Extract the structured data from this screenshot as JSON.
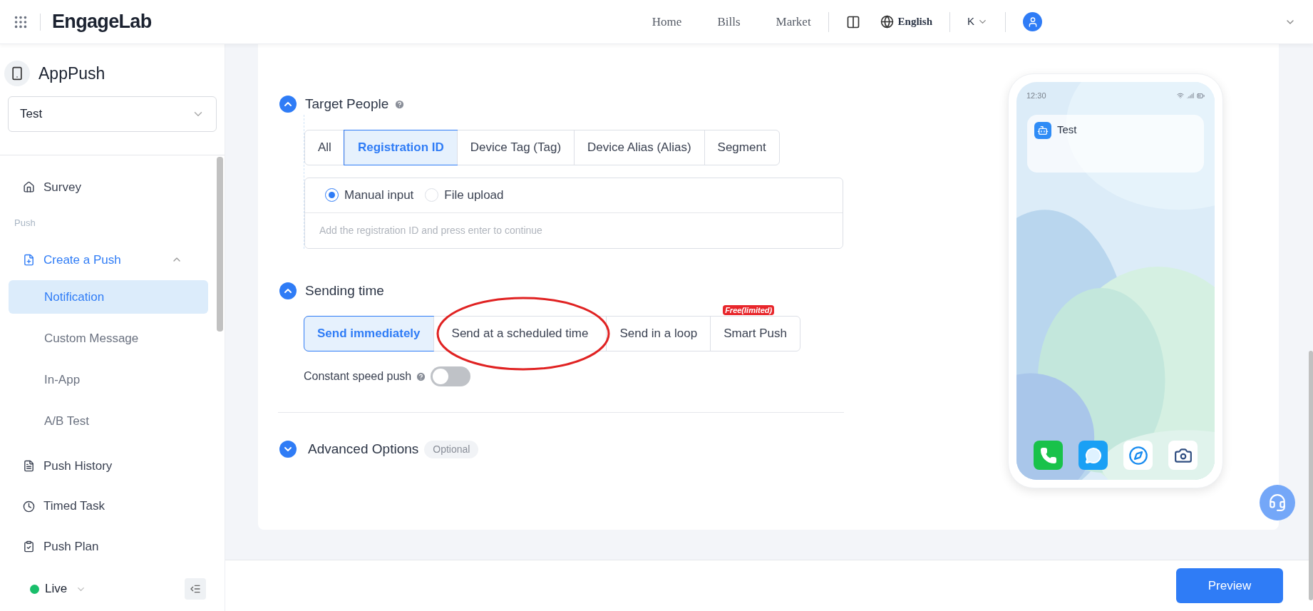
{
  "header": {
    "logo": "EngageLab",
    "nav": [
      {
        "label": "Home"
      },
      {
        "label": "Bills"
      },
      {
        "label": "Market"
      }
    ],
    "language": "English",
    "account": "K"
  },
  "sidebar": {
    "app_name": "AppPush",
    "app_select": "Test",
    "items": [
      {
        "kind": "item",
        "label": "Survey",
        "selected": false
      },
      {
        "kind": "section",
        "label": "Push"
      },
      {
        "kind": "group",
        "label": "Create a Push",
        "expanded": true,
        "children": [
          {
            "label": "Notification",
            "selected": true
          },
          {
            "label": "Custom Message",
            "selected": false
          },
          {
            "label": "In-App",
            "selected": false
          },
          {
            "label": "A/B Test",
            "selected": false
          }
        ]
      },
      {
        "kind": "item",
        "label": "Push History",
        "selected": false
      },
      {
        "kind": "item",
        "label": "Timed Task",
        "selected": false
      },
      {
        "kind": "item",
        "label": "Push Plan",
        "selected": false
      }
    ],
    "status": {
      "label": "Live",
      "color": "#19be6b"
    }
  },
  "target_people": {
    "title": "Target People",
    "expanded": true,
    "tabs": [
      {
        "label": "All",
        "selected": false
      },
      {
        "label": "Registration ID",
        "selected": true
      },
      {
        "label": "Device Tag (Tag)",
        "selected": false
      },
      {
        "label": "Device Alias (Alias)",
        "selected": false
      },
      {
        "label": "Segment",
        "selected": false
      }
    ],
    "input_modes": [
      {
        "label": "Manual input",
        "selected": true
      },
      {
        "label": "File upload",
        "selected": false
      }
    ],
    "placeholder": "Add the registration ID and press enter to continue"
  },
  "sending_time": {
    "title": "Sending time",
    "expanded": true,
    "options": [
      {
        "label": "Send immediately",
        "selected": true
      },
      {
        "label": "Send at a scheduled time",
        "selected": false
      },
      {
        "label": "Send in a loop",
        "selected": false
      },
      {
        "label": "Smart Push",
        "selected": false,
        "badge": "Free(limited)"
      }
    ],
    "constant_speed": {
      "label": "Constant speed push",
      "on": false
    }
  },
  "advanced": {
    "title": "Advanced Options",
    "tag": "Optional",
    "expanded": false
  },
  "preview": {
    "time": "12:30",
    "notification_title": "Test"
  },
  "footer": {
    "button": "Preview"
  }
}
